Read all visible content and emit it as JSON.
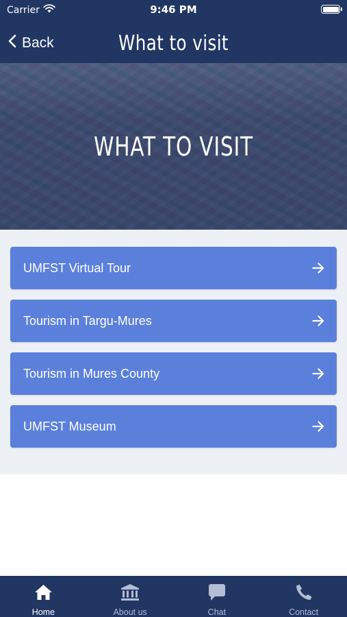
{
  "status_bar": {
    "carrier": "Carrier",
    "time": "9:46 PM"
  },
  "nav": {
    "back_label": "Back",
    "title": "What to visit"
  },
  "hero": {
    "title": "WHAT TO VISIT"
  },
  "items": [
    {
      "label": "UMFST Virtual Tour",
      "icon": "arrow-right-icon"
    },
    {
      "label": "Tourism in Targu-Mures",
      "icon": "arrow-right-icon"
    },
    {
      "label": "Tourism in Mures County",
      "icon": "arrow-right-icon"
    },
    {
      "label": "UMFST Museum",
      "icon": "arrow-right-icon"
    }
  ],
  "tabs": [
    {
      "label": "Home",
      "icon": "home-icon",
      "active": true
    },
    {
      "label": "About us",
      "icon": "institution-icon",
      "active": false
    },
    {
      "label": "Chat",
      "icon": "chat-icon",
      "active": false
    },
    {
      "label": "Contact",
      "icon": "phone-icon",
      "active": false
    }
  ],
  "colors": {
    "nav_bg": "#213663",
    "item_bg": "#5b80dc",
    "list_bg": "#edf0f4"
  }
}
